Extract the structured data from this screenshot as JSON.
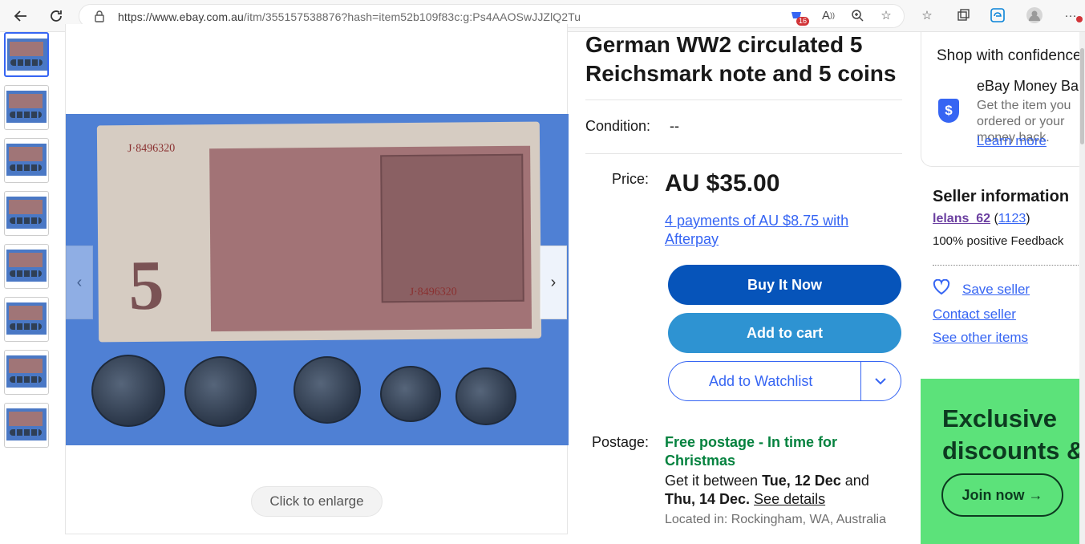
{
  "browser": {
    "url_host": "https://www.ebay.com.au",
    "url_path": "/itm/355157538876?hash=item52b109f83c:g:Ps4AAOSwJJZlQ2Tu",
    "extension_badge": "16"
  },
  "gallery": {
    "photo_note_number": "J·8496320",
    "photo_note_number_2": "J·8496320",
    "photo_denomination": "5",
    "enlarge_label": "Click to enlarge"
  },
  "listing": {
    "title": "German WW2 circulated 5 Reichsmark note and 5 coins",
    "condition_label": "Condition:",
    "condition_value": "--",
    "price_label": "Price:",
    "price": "AU $35.00",
    "afterpay_link": "4 payments of AU $8.75 with Afterpay",
    "buy_now": "Buy It Now",
    "add_to_cart": "Add to cart",
    "add_to_watchlist": "Add to Watchlist",
    "postage_label": "Postage:",
    "postage_free": "Free postage - In time for Christmas",
    "postage_between": "Get it between ",
    "postage_date1": "Tue, 12 Dec",
    "postage_and": " and ",
    "postage_date2": "Thu, 14 Dec.",
    "see_details": "See details",
    "located": "Located in: Rockingham, WA, Australia"
  },
  "sidebar": {
    "shop_title": "Shop with confidence",
    "money_back_title": "eBay Money Back",
    "money_back_desc": "Get the item you ordered or your money back.",
    "learn_more": "Learn more",
    "seller_title": "Seller information",
    "seller_name": "lelans_62",
    "seller_count": "1123",
    "seller_feedback": "100% positive Feedback",
    "save_seller": "Save seller",
    "contact_seller": "Contact seller",
    "see_other_items": "See other items"
  },
  "promo": {
    "line1": "Exclusive",
    "line2": "discounts &",
    "join": "Join now →"
  },
  "colors": {
    "buy_now": "#0654ba",
    "add_to_cart": "#2e93d2",
    "link": "#3665f3",
    "free_postage": "#05823f",
    "promo_bg": "#5ce27a"
  }
}
